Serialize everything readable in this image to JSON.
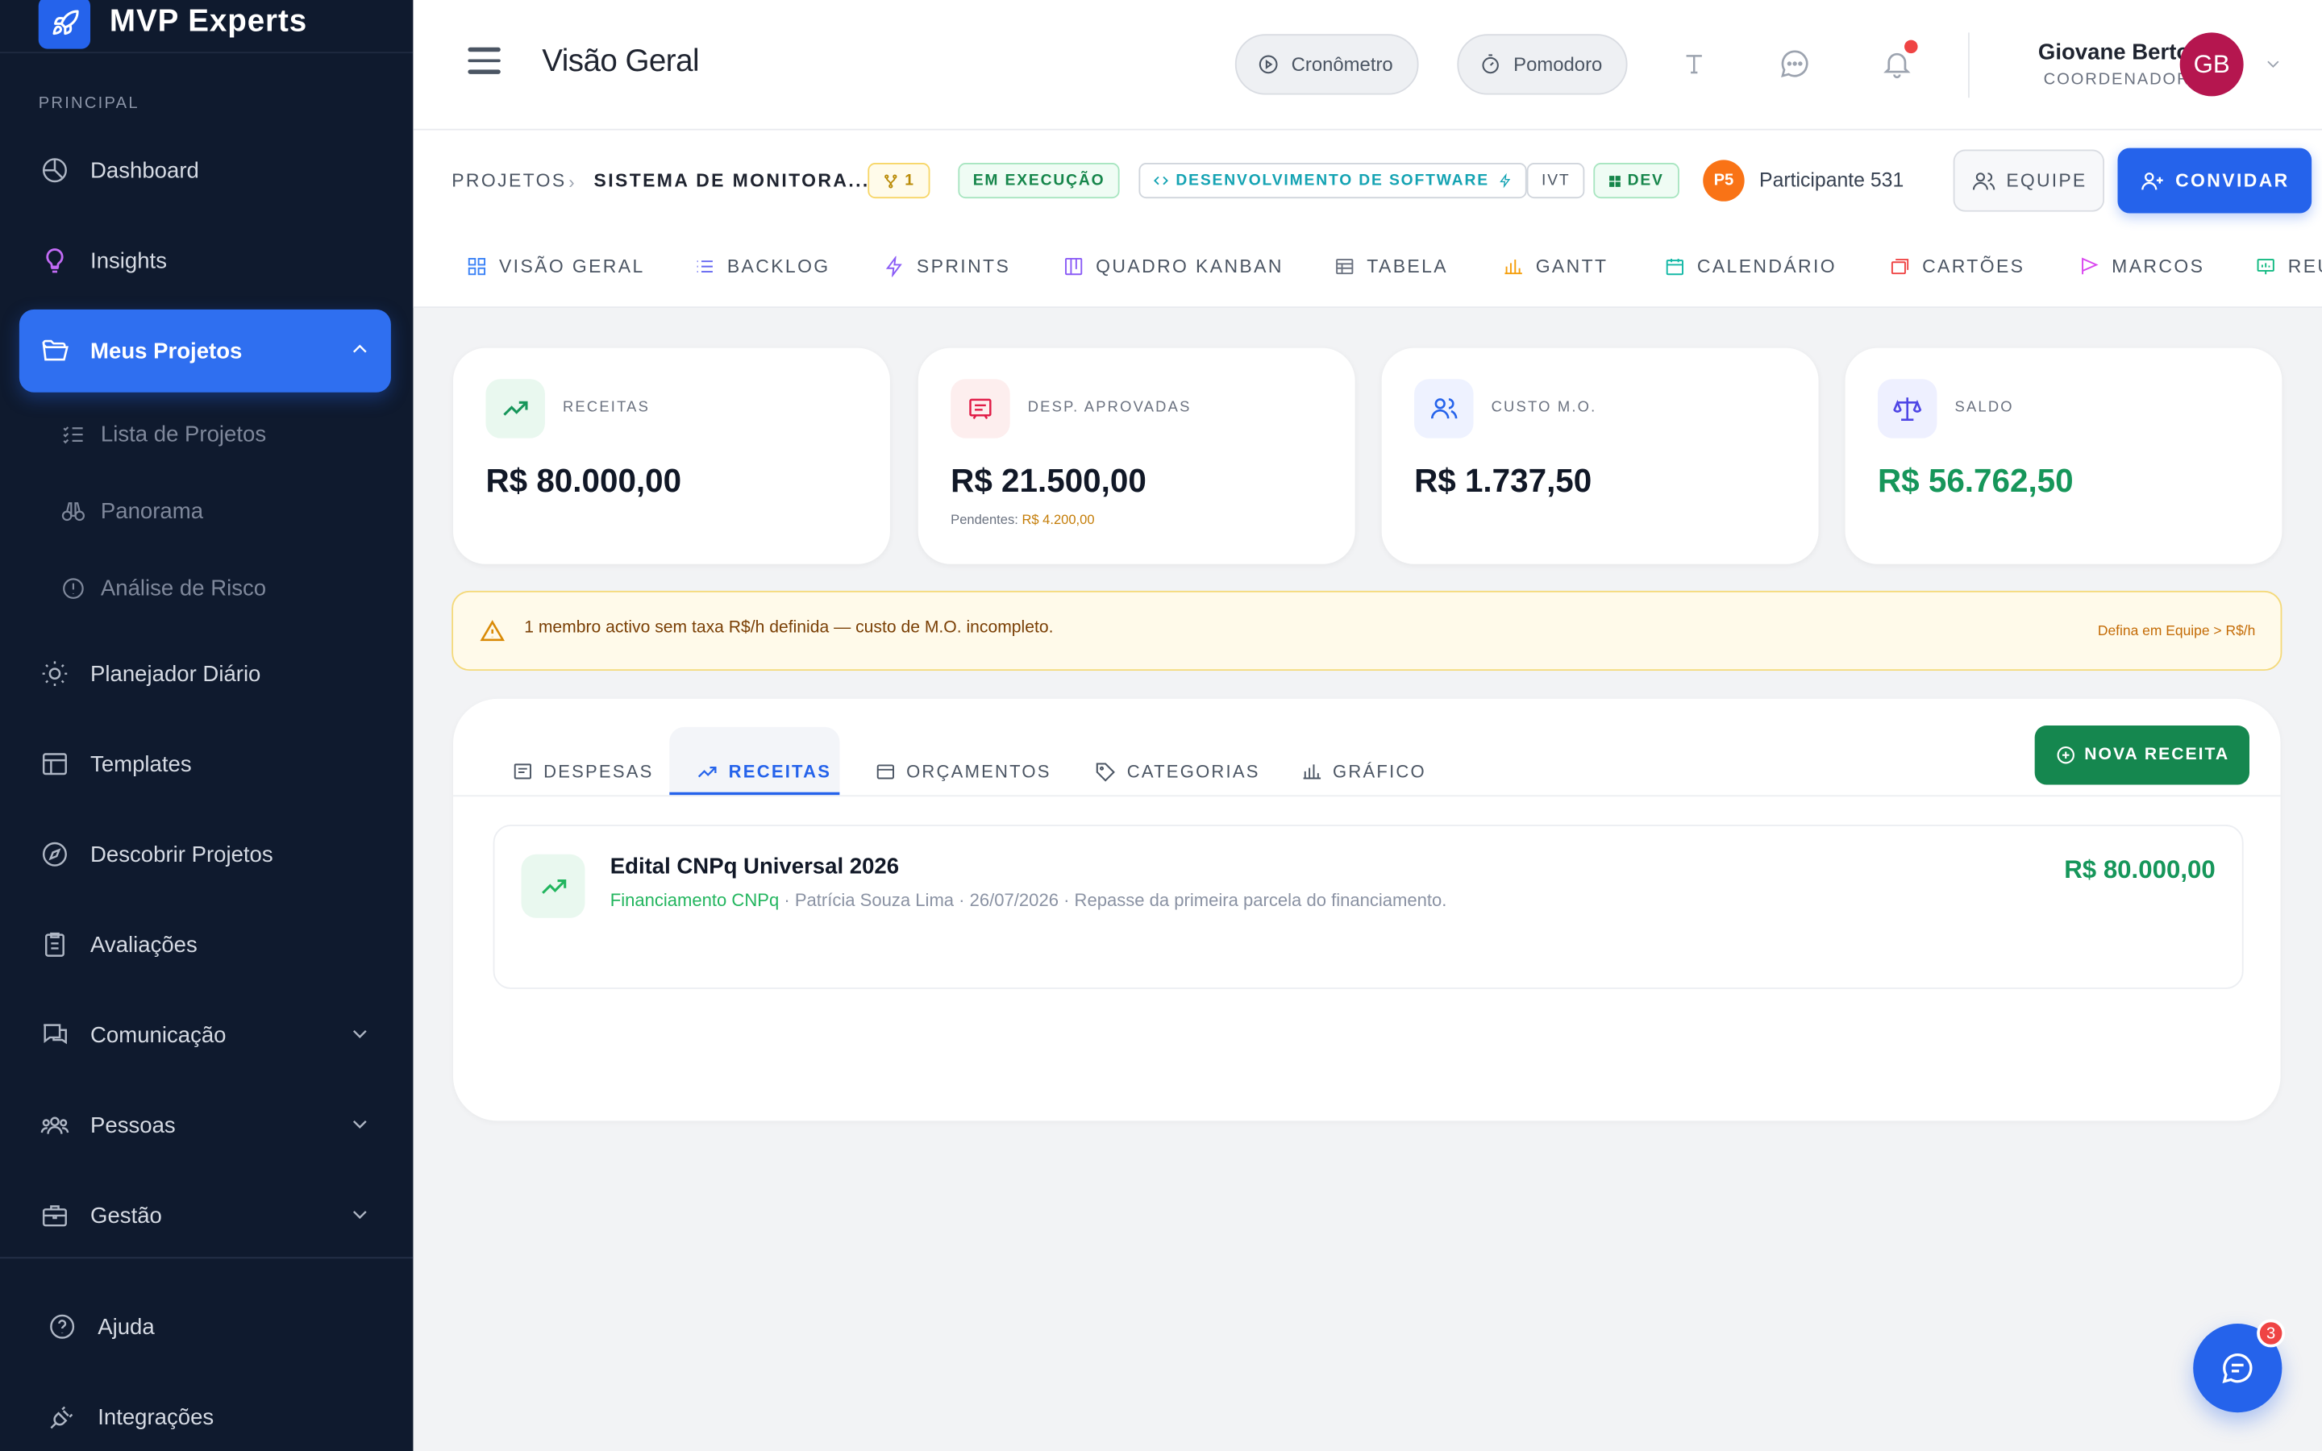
{
  "brand": {
    "name": "MVP Experts",
    "logo_icon": "rocket-icon"
  },
  "sidebar": {
    "section_label": "PRINCIPAL",
    "items": [
      {
        "label": "Dashboard",
        "icon": "chart-pie-icon"
      },
      {
        "label": "Insights",
        "icon": "lightbulb-icon"
      },
      {
        "label": "Meus Projetos",
        "icon": "folder-open-icon",
        "active": true,
        "expanded": true
      },
      {
        "label": "Planejador Diário",
        "icon": "sun-icon"
      },
      {
        "label": "Templates",
        "icon": "layout-icon"
      },
      {
        "label": "Descobrir Projetos",
        "icon": "compass-icon"
      },
      {
        "label": "Avaliações",
        "icon": "clipboard-icon"
      },
      {
        "label": "Comunicação",
        "icon": "chat-bubbles-icon"
      },
      {
        "label": "Pessoas",
        "icon": "users-icon"
      },
      {
        "label": "Gestão",
        "icon": "briefcase-icon"
      }
    ],
    "sub_items": [
      {
        "label": "Lista de Projetos",
        "icon": "list-check-icon"
      },
      {
        "label": "Panorama",
        "icon": "binoculars-icon"
      },
      {
        "label": "Análise de Risco",
        "icon": "alert-circle-icon"
      }
    ],
    "footer": [
      {
        "label": "Ajuda",
        "icon": "help-circle-icon"
      },
      {
        "label": "Integrações",
        "icon": "plug-icon"
      }
    ]
  },
  "header": {
    "title": "Visão Geral",
    "timer_label": "Cronômetro",
    "pomodoro_label": "Pomodoro",
    "user": {
      "name": "Giovane Bertol",
      "role": "COORDENADOR",
      "initials": "GB"
    }
  },
  "project": {
    "breadcrumb_root": "PROJETOS",
    "breadcrumb_current": "SISTEMA DE MONITORA...",
    "branch_count": "1",
    "status": "EM EXECUÇÃO",
    "category": "DESENVOLVIMENTO DE SOFTWARE",
    "tag_ivt": "IVT",
    "tag_dev": "DEV",
    "participant_initials": "P5",
    "participant_name": "Participante 531",
    "team_label": "EQUIPE",
    "invite_label": "CONVIDAR",
    "tabs": [
      "VISÃO GERAL",
      "BACKLOG",
      "SPRINTS",
      "QUADRO KANBAN",
      "TABELA",
      "GANTT",
      "CALENDÁRIO",
      "CARTÕES",
      "MARCOS",
      "REU"
    ]
  },
  "stats": [
    {
      "label": "RECEITAS",
      "value": "R$ 80.000,00",
      "icon": "trending-up-icon"
    },
    {
      "label": "DESP. APROVADAS",
      "value": "R$ 21.500,00",
      "icon": "receipt-icon",
      "sub_label": "Pendentes:",
      "sub_value": "R$ 4.200,00"
    },
    {
      "label": "CUSTO M.O.",
      "value": "R$ 1.737,50",
      "icon": "users-icon"
    },
    {
      "label": "SALDO",
      "value": "R$ 56.762,50",
      "icon": "scale-icon"
    }
  ],
  "warning": {
    "text": "1 membro activo sem taxa R$/h definida — custo de M.O. incompleto.",
    "link": "Defina em Equipe > R$/h"
  },
  "finance": {
    "tabs": [
      "DESPESAS",
      "RECEITAS",
      "ORÇAMENTOS",
      "CATEGORIAS",
      "GRÁFICO"
    ],
    "active_tab": "RECEITAS",
    "new_button": "NOVA RECEITA",
    "entries": [
      {
        "title": "Edital CNPq Universal 2026",
        "category": "Financiamento CNPq",
        "details": " · Patrícia Souza Lima · 26/07/2026 · Repasse da primeira parcela do financiamento.",
        "amount": "R$ 80.000,00"
      }
    ]
  },
  "chat": {
    "unread": "3"
  },
  "colors": {
    "sidebar_bg": "#0f1a2e",
    "primary": "#2563eb",
    "success": "#16965a",
    "warning_bg": "#fffaea"
  }
}
